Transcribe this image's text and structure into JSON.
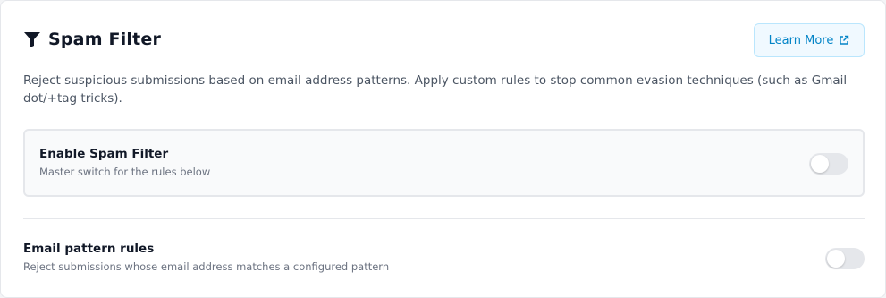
{
  "header": {
    "icon": "filter-icon",
    "title": "Spam Filter"
  },
  "learn_more": {
    "label": "Learn More",
    "icon": "external-link-icon",
    "color": "#0284c7"
  },
  "description": "Reject suspicious submissions based on email address patterns. Apply custom rules to stop common evasion techniques (such as Gmail dot/+tag tricks).",
  "master_switch": {
    "title": "Enable Spam Filter",
    "subtitle": "Master switch for the rules below",
    "enabled": false
  },
  "email_rules": {
    "title": "Email pattern rules",
    "subtitle": "Reject submissions whose email address matches a configured pattern",
    "enabled": false
  }
}
